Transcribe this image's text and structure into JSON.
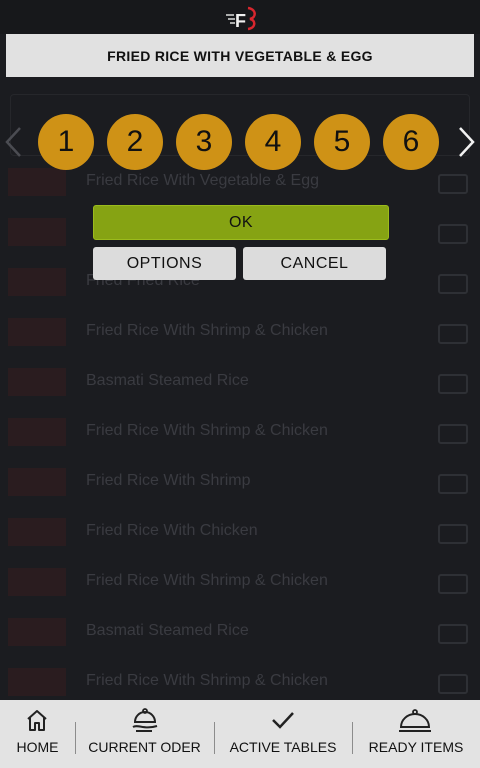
{
  "app": {
    "logo_text": "F"
  },
  "title_bar": {
    "title": "FRIED RICE WITH VEGETABLE & EGG"
  },
  "background_list": [
    {
      "name": "Fried Rice With Vegetable & Egg",
      "sub": ""
    },
    {
      "name": "",
      "sub": ""
    },
    {
      "name": "Fried Fried Rice",
      "sub": ""
    },
    {
      "name": "Fried Rice With Shrimp & Chicken",
      "sub": ""
    },
    {
      "name": "Basmati Steamed Rice",
      "sub": ""
    },
    {
      "name": "Fried Rice With Shrimp & Chicken",
      "sub": ""
    },
    {
      "name": "Fried Rice With Shrimp",
      "sub": ""
    },
    {
      "name": "Fried Rice With Chicken",
      "sub": ""
    },
    {
      "name": "Fried Rice With Shrimp & Chicken",
      "sub": ""
    },
    {
      "name": "Basmati Steamed Rice",
      "sub": ""
    },
    {
      "name": "Fried Rice With Shrimp & Chicken",
      "sub": ""
    }
  ],
  "quantity": {
    "options": [
      "1",
      "2",
      "3",
      "4",
      "5",
      "6"
    ]
  },
  "dialog": {
    "ok_label": "OK",
    "options_label": "OPTIONS",
    "cancel_label": "CANCEL"
  },
  "nav": {
    "home": "HOME",
    "current_order": "CURRENT ODER",
    "active_tables": "ACTIVE TABLES",
    "ready_items": "READY ITEMS"
  },
  "colors": {
    "accent_gold": "#cf9216",
    "ok_green": "#86a313",
    "brand_red": "#d8262e",
    "background": "#1b1c20"
  }
}
